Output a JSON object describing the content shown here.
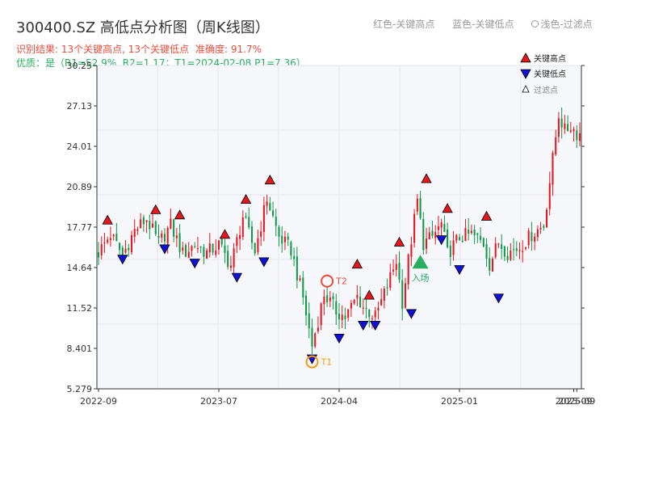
{
  "title": "300400.SZ 高低点分析图（周K线图）",
  "top_legend": {
    "red_label": "红色-关键高点",
    "blue_label": "蓝色-关键低点",
    "filtered_label": "浅色-过滤点"
  },
  "info": {
    "result": "识别结果: 13个关键高点, 13个关键低点",
    "accuracy": "准确度: 91.7%",
    "quality": "优质：是（R1=52.9%, R2=1.17；T1=2024-02-08 P1=7.36）"
  },
  "legend": {
    "high": "关键高点",
    "low": "关键低点",
    "filtered": "过滤点"
  },
  "colors": {
    "up": "#e8141e",
    "down": "#0f9948",
    "high_marker": "#e8141e",
    "low_marker": "#1010d8",
    "entry": "#27ae60",
    "t_marker": "#f39c12",
    "t2_marker": "#e74c3c",
    "plot_bg": "#f5f7fa"
  },
  "chart_data": {
    "type": "candlestick",
    "ylim": [
      5.279,
      30.25
    ],
    "yticks": [
      "5.279",
      "8.401",
      "11.52",
      "14.64",
      "17.77",
      "20.89",
      "24.01",
      "27.13",
      "30.25"
    ],
    "x_range_weeks": [
      0,
      160
    ],
    "xticks": [
      {
        "week": 0,
        "label": "2022-09"
      },
      {
        "week": 40,
        "label": "2023-07"
      },
      {
        "week": 80,
        "label": "2024-04"
      },
      {
        "week": 120,
        "label": "2025-01"
      },
      {
        "week": 158,
        "label": "2025-09"
      },
      {
        "week": 159,
        "label": "2025-09"
      }
    ],
    "close_waypoints": [
      [
        0,
        15.8
      ],
      [
        4,
        17.2
      ],
      [
        8,
        15.6
      ],
      [
        12,
        17.5
      ],
      [
        16,
        18.4
      ],
      [
        20,
        16.5
      ],
      [
        24,
        17.9
      ],
      [
        28,
        15.7
      ],
      [
        32,
        16.4
      ],
      [
        36,
        15.8
      ],
      [
        40,
        16.4
      ],
      [
        44,
        14.8
      ],
      [
        48,
        18.6
      ],
      [
        52,
        15.9
      ],
      [
        56,
        20.0
      ],
      [
        60,
        17.0
      ],
      [
        64,
        16.0
      ],
      [
        68,
        12.3
      ],
      [
        71,
        8.6
      ],
      [
        75,
        12.6
      ],
      [
        79,
        11.3
      ],
      [
        82,
        10.8
      ],
      [
        86,
        12.4
      ],
      [
        88,
        11.6
      ],
      [
        92,
        10.8
      ],
      [
        96,
        13.2
      ],
      [
        99,
        15.2
      ],
      [
        101,
        12.0
      ],
      [
        104,
        16.8
      ],
      [
        106,
        19.8
      ],
      [
        108,
        16.5
      ],
      [
        111,
        17.0
      ],
      [
        114,
        18.0
      ],
      [
        116,
        15.7
      ],
      [
        120,
        17.0
      ],
      [
        124,
        17.2
      ],
      [
        128,
        16.5
      ],
      [
        130,
        14.9
      ],
      [
        133,
        16.6
      ],
      [
        136,
        15.8
      ],
      [
        140,
        16.2
      ],
      [
        144,
        17.2
      ],
      [
        148,
        17.9
      ],
      [
        151,
        23.0
      ],
      [
        153,
        26.5
      ],
      [
        155,
        25.2
      ],
      [
        157,
        25.6
      ],
      [
        159,
        25.0
      ]
    ],
    "key_highs": [
      {
        "week": 3,
        "price": 18.3
      },
      {
        "week": 19,
        "price": 19.1
      },
      {
        "week": 27,
        "price": 18.7
      },
      {
        "week": 42,
        "price": 17.2
      },
      {
        "week": 49,
        "price": 19.9
      },
      {
        "week": 57,
        "price": 21.4
      },
      {
        "week": 86,
        "price": 14.9
      },
      {
        "week": 90,
        "price": 12.5
      },
      {
        "week": 100,
        "price": 16.6
      },
      {
        "week": 109,
        "price": 21.5
      },
      {
        "week": 116,
        "price": 19.2
      },
      {
        "week": 129,
        "price": 18.6
      }
    ],
    "key_lows": [
      {
        "week": 8,
        "price": 15.3
      },
      {
        "week": 22,
        "price": 16.1
      },
      {
        "week": 32,
        "price": 15.0
      },
      {
        "week": 46,
        "price": 13.9
      },
      {
        "week": 55,
        "price": 15.1
      },
      {
        "week": 71,
        "price": 7.6
      },
      {
        "week": 80,
        "price": 9.2
      },
      {
        "week": 88,
        "price": 10.2
      },
      {
        "week": 92,
        "price": 10.2
      },
      {
        "week": 104,
        "price": 11.1
      },
      {
        "week": 114,
        "price": 16.8
      },
      {
        "week": 120,
        "price": 14.5
      },
      {
        "week": 133,
        "price": 12.3
      }
    ],
    "annotations": {
      "t1": {
        "label": "T1",
        "week": 71,
        "price": 7.36
      },
      "t2": {
        "label": "T2",
        "week": 76,
        "price": 13.6
      },
      "entry": {
        "label": "入场",
        "week": 107,
        "price": 15.0
      }
    }
  }
}
